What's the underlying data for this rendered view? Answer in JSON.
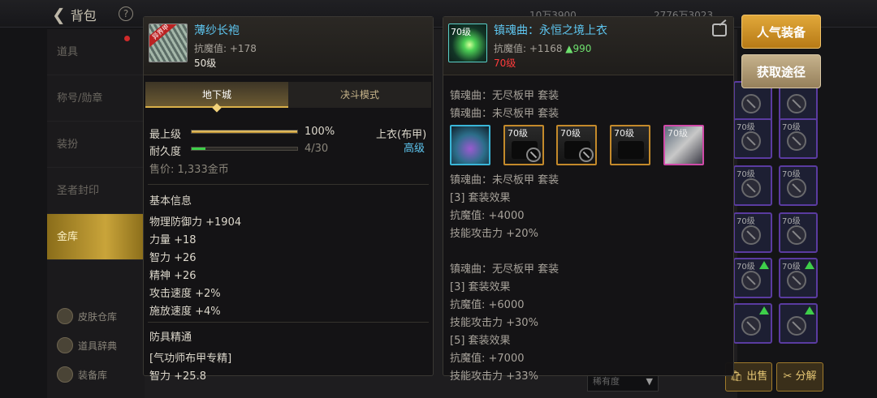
{
  "topbar": {
    "back_label": "背包",
    "help": "?",
    "currency1": "10万3900",
    "currency2": "2776万3023"
  },
  "sidebar": {
    "items": [
      "道具",
      "称号/勋章",
      "装扮",
      "圣者封印",
      "金库"
    ],
    "active": 4,
    "footer": [
      "皮肤仓库",
      "道具辞典",
      "装备库"
    ]
  },
  "item_left": {
    "name": "薄纱长袍",
    "badge": "异界甲",
    "stat_label": "抗魔值:",
    "stat_value": "+178",
    "level": "50级",
    "tabs": [
      "地下城",
      "决斗模式"
    ],
    "active_tab": 0,
    "rows": {
      "max_label": "最上级",
      "max_value": "100%",
      "max_fill": 1.0,
      "dur_label": "耐久度",
      "dur_value": "4/30",
      "dur_fill": 0.133,
      "slot_label": "上衣(布甲)",
      "grade": "高级",
      "price": "售价: 1,333金币"
    },
    "basic_title": "基本信息",
    "basic": [
      "物理防御力 +1904",
      "力量 +18",
      "智力 +26",
      "精神 +26",
      "攻击速度 +2%",
      "施放速度 +4%"
    ],
    "mastery_title": "防具精通",
    "mastery": [
      "[气功师布甲专精]",
      "智力 +25.8"
    ]
  },
  "item_right": {
    "icon_level": "70级",
    "name": "镇魂曲：永恒之境上衣",
    "stat_label": "抗魔值:",
    "stat_value": "+1168",
    "stat_up": "▲990",
    "level": "70级",
    "set_lines_top": [
      "镇魂曲：无尽板甲 套装",
      "镇魂曲：未尽板甲 套装"
    ],
    "slots": [
      {
        "level": "",
        "style": "blue"
      },
      {
        "level": "70级",
        "style": "dk"
      },
      {
        "level": "70级",
        "style": "dk"
      },
      {
        "level": "70级",
        "style": "dk"
      },
      {
        "level": "70级",
        "style": "pink"
      }
    ],
    "set_lines": [
      "镇魂曲：未尽板甲 套装",
      "[3] 套装效果",
      "抗魔值: +4000",
      "技能攻击力 +20%",
      "镇魂曲：无尽板甲 套装",
      "[3] 套装效果",
      "抗魔值: +6000",
      "技能攻击力 +30%",
      "[5] 套装效果",
      "抗魔值: +7000",
      "技能攻击力 +33%"
    ]
  },
  "buttons": {
    "popular": "人气装备",
    "obtain": "获取途径",
    "sell": "出售",
    "decompose": "分解"
  },
  "sort": {
    "label": "稀有度",
    "arrow": "▼"
  },
  "grid_levels": [
    "70级",
    "70级",
    "70级",
    "70级",
    "70级",
    "70级",
    "70级",
    "70级"
  ]
}
